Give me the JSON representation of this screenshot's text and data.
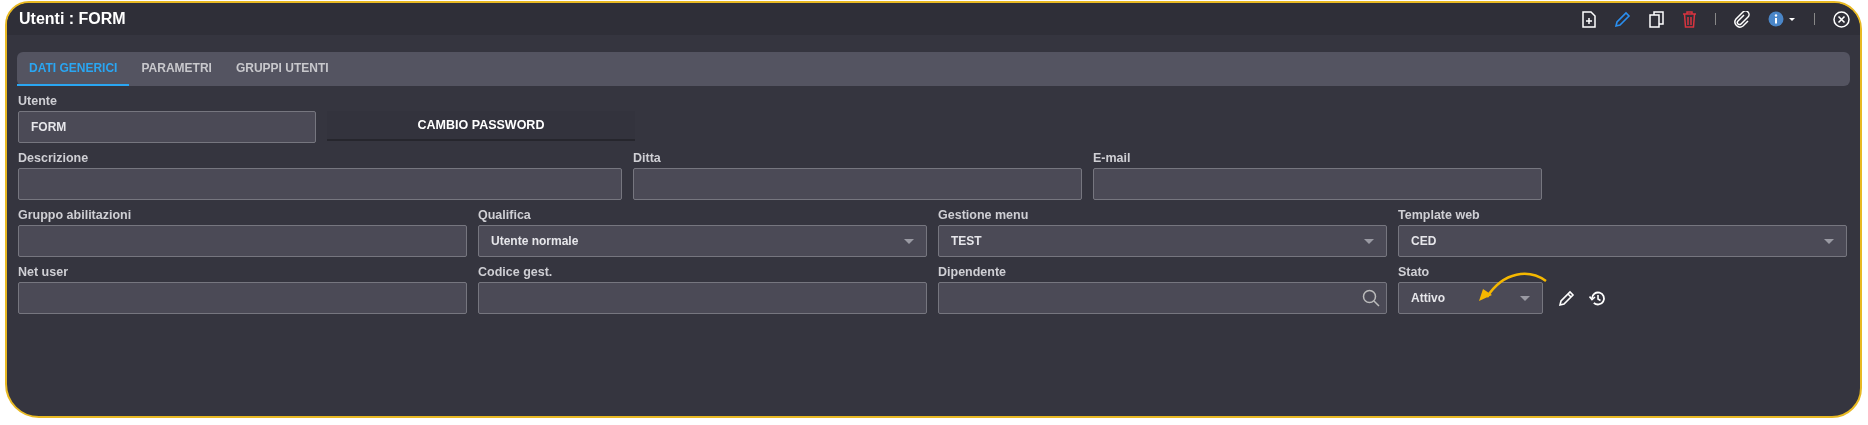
{
  "window": {
    "title": "Utenti : FORM"
  },
  "tabs": [
    {
      "label": "DATI GENERICI",
      "selected": true
    },
    {
      "label": "PARAMETRI",
      "selected": false
    },
    {
      "label": "GRUPPI UTENTI",
      "selected": false
    }
  ],
  "form_rows": [
    [
      {
        "kind": "text",
        "label": "Utente",
        "value": "FORM"
      },
      {
        "kind": "button",
        "label": "CAMBIO PASSWORD"
      }
    ],
    [
      {
        "kind": "text",
        "label": "Descrizione"
      },
      {
        "kind": "text",
        "label": "Ditta"
      },
      {
        "kind": "text",
        "label": "E-mail"
      }
    ],
    [
      {
        "kind": "text",
        "label": "Gruppo abilitazioni"
      },
      {
        "kind": "select",
        "label": "Qualifica",
        "value": "Utente normale"
      },
      {
        "kind": "select",
        "label": "Gestione menu",
        "value": "TEST"
      },
      {
        "kind": "select",
        "label": "Template web",
        "value": "CED"
      }
    ],
    [
      {
        "kind": "text",
        "label": "Net user"
      },
      {
        "kind": "text",
        "label": "Codice gest."
      },
      {
        "kind": "search",
        "label": "Dipendente"
      },
      {
        "kind": "status",
        "label": "Stato",
        "value": "Attivo"
      }
    ]
  ]
}
